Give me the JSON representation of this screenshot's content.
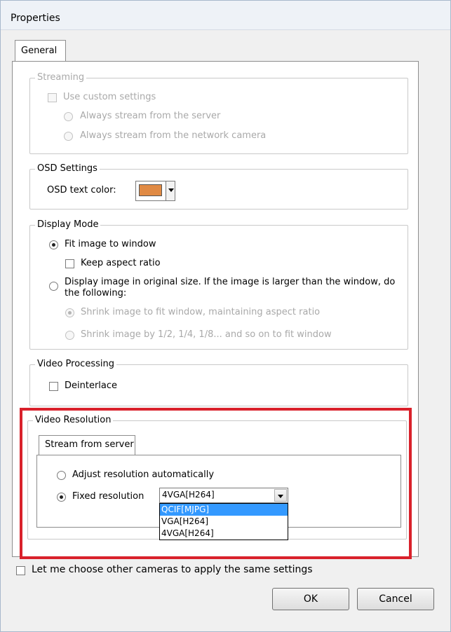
{
  "window": {
    "title": "Properties"
  },
  "tabs": {
    "general": "General"
  },
  "streaming": {
    "legend": "Streaming",
    "use_custom": "Use custom settings",
    "always_server": "Always stream from the server",
    "always_camera": "Always stream from the network camera"
  },
  "osd": {
    "legend": "OSD Settings",
    "text_color_label": "OSD text color:",
    "text_color": "#e08a44"
  },
  "display": {
    "legend": "Display Mode",
    "fit_window": "Fit image to window",
    "keep_aspect": "Keep aspect ratio",
    "original_size_line1": "Display image in original size. If the image is larger than the window, do",
    "original_size_line2": "the following:",
    "shrink_fit": "Shrink image to fit window, maintaining aspect ratio",
    "shrink_half": "Shrink image by 1/2, 1/4, 1/8... and so on to fit window"
  },
  "video_processing": {
    "legend": "Video Processing",
    "deinterlace": "Deinterlace"
  },
  "video_resolution": {
    "legend": "Video Resolution",
    "tab": "Stream from server",
    "adjust_auto": "Adjust resolution automatically",
    "fixed": "Fixed resolution",
    "selected": "4VGA[H264]",
    "options": [
      "QCIF[MJPG]",
      "VGA[H264]",
      "4VGA[H264]"
    ]
  },
  "footer": {
    "apply_others": "Let me choose other cameras to apply the same settings",
    "ok": "OK",
    "cancel": "Cancel"
  }
}
